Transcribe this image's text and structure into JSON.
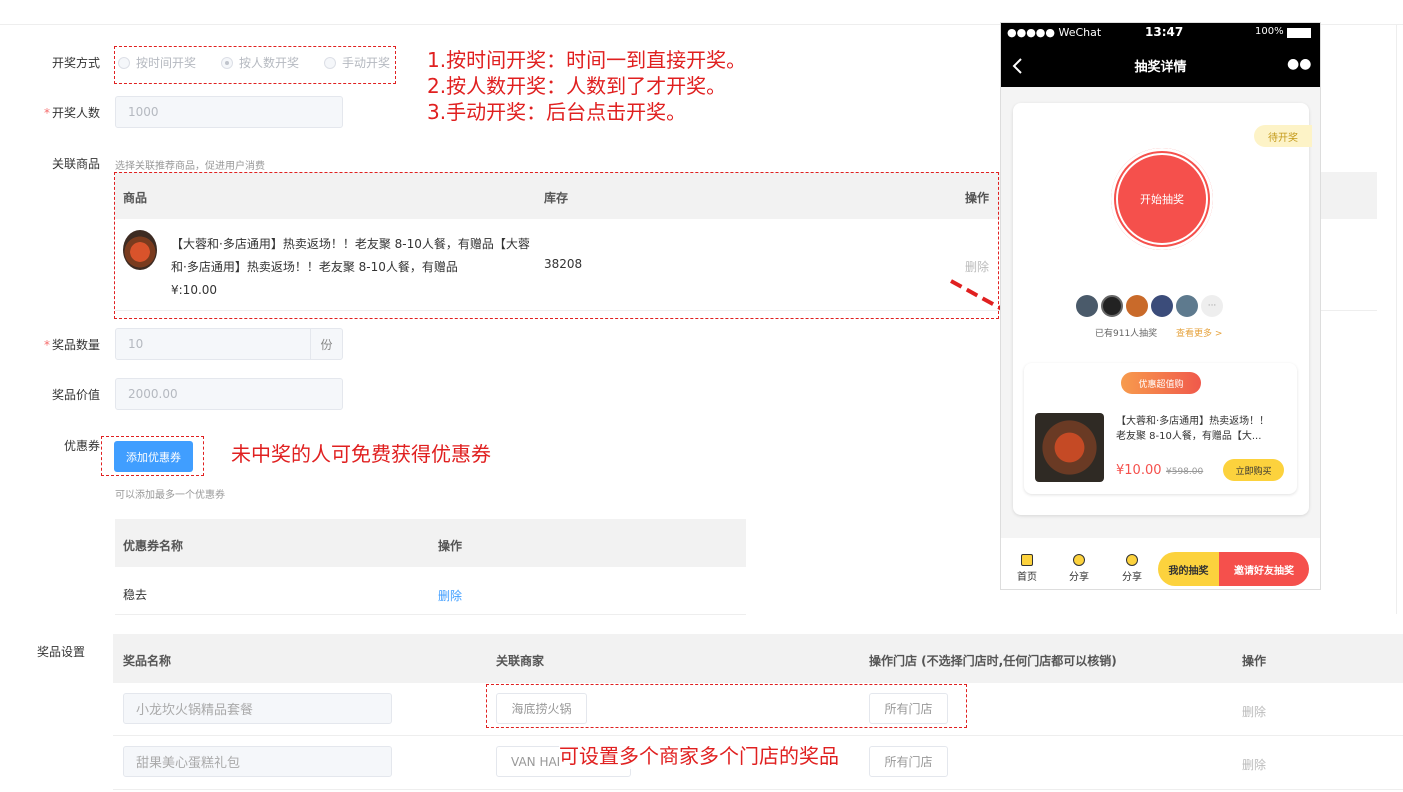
{
  "form": {
    "draw_mode_label": "开奖方式",
    "draw_mode_options": [
      "按时间开奖",
      "按人数开奖",
      "手动开奖"
    ],
    "draw_count_label": "开奖人数",
    "draw_count_placeholder": "1000",
    "related_goods_label": "关联商品",
    "related_goods_hint": "选择关联推荐商品，促进用户消费",
    "goods_table": {
      "headers": [
        "商品",
        "库存",
        "操作"
      ],
      "row": {
        "name_line1": "【大蓉和·多店通用】热卖返场！！老友聚 8-10人餐，有赠品【大蓉",
        "name_line2": "和·多店通用】热卖返场！！老友聚 8-10人餐，有赠品",
        "price": "¥:10.00",
        "stock": "38208",
        "action": "删除"
      }
    },
    "prize_qty_label": "奖品数量",
    "prize_qty_placeholder": "10",
    "prize_qty_unit": "份",
    "prize_value_label": "奖品价值",
    "prize_value_placeholder": "2000.00",
    "coupon_label": "优惠券",
    "add_coupon_button": "添加优惠券",
    "coupon_hint": "可以添加最多一个优惠券",
    "coupon_table": {
      "headers": [
        "优惠券名称",
        "操作"
      ],
      "row": {
        "name": "稳去",
        "action": "删除"
      }
    },
    "prize_settings_label": "奖品设置",
    "prize_table": {
      "headers": [
        "奖品名称",
        "关联商家",
        "操作门店 (不选择门店时,任何门店都可以核销)",
        "操作"
      ],
      "rows": [
        {
          "name": "小龙坎火锅精品套餐",
          "merchant": "海底捞火锅",
          "store": "所有门店",
          "action": "删除"
        },
        {
          "name": "甜果美心蛋糕礼包",
          "merchant": "VAN HAI",
          "store": "所有门店",
          "action": "删除"
        }
      ]
    }
  },
  "annotations": {
    "mode_notes": [
      "1.按时间开奖：时间一到直接开奖。",
      "2.按人数开奖：人数到了才开奖。",
      "3.手动开奖：后台点击开奖。"
    ],
    "coupon_note": "未中奖的人可免费获得优惠券",
    "prize_note": "可设置多个商家多个门店的奖品"
  },
  "phone": {
    "carrier": "●●●●● WeChat",
    "time": "13:47",
    "battery": "100%",
    "title": "抽奖详情",
    "status_tag": "待开奖",
    "start_button": "开始抽奖",
    "participants_text": "已有911人抽奖",
    "view_more": "查看更多 >",
    "promo_tag": "优惠超值购",
    "product_title_line1": "【大蓉和·多店通用】热卖返场！！",
    "product_title_line2": "老友聚 8-10人餐，有赠品【大...",
    "price": "¥10.00",
    "old_price": "¥598.00",
    "buy_button": "立即购买",
    "tabs": [
      "首页",
      "分享",
      "分享"
    ],
    "my_lottery": "我的抽奖",
    "invite": "邀请好友抽奖",
    "colors": {
      "accent_red": "#f5504c",
      "accent_yellow": "#fcd23d"
    }
  }
}
